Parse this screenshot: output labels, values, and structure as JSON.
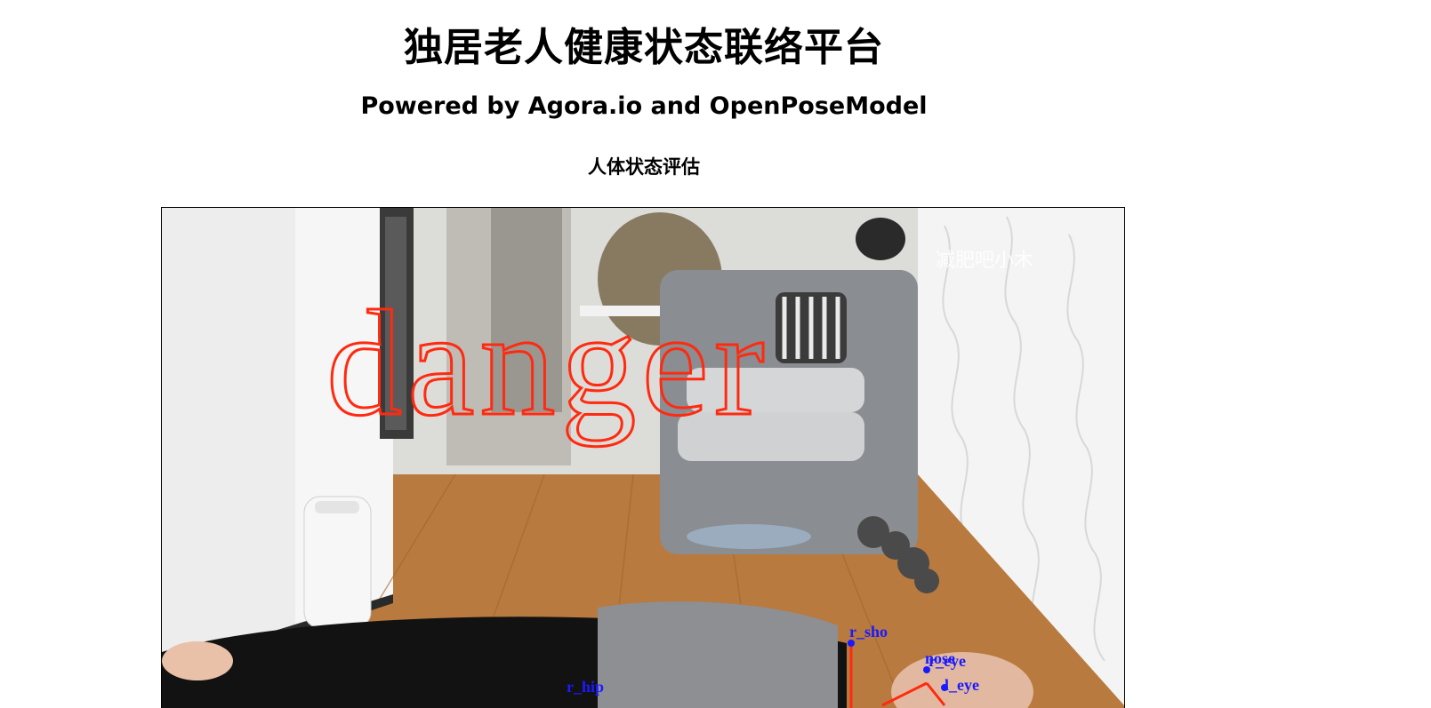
{
  "header": {
    "title": "独居老人健康状态联络平台",
    "subtitle": "Powered by Agora.io and OpenPoseModel"
  },
  "section": {
    "title": "人体状态评估"
  },
  "video": {
    "status_label": "danger",
    "status_color": "#ff2a10",
    "watermark": "减肥吧小木",
    "keypoints": {
      "r_sho": "r_sho",
      "nose": "nose",
      "r_eye": "r_eye",
      "l_eye": "l_eye",
      "r_hip": "r_hip"
    },
    "keypoint_color": "#1a1aff",
    "skeleton_color": "#ff2a10"
  }
}
